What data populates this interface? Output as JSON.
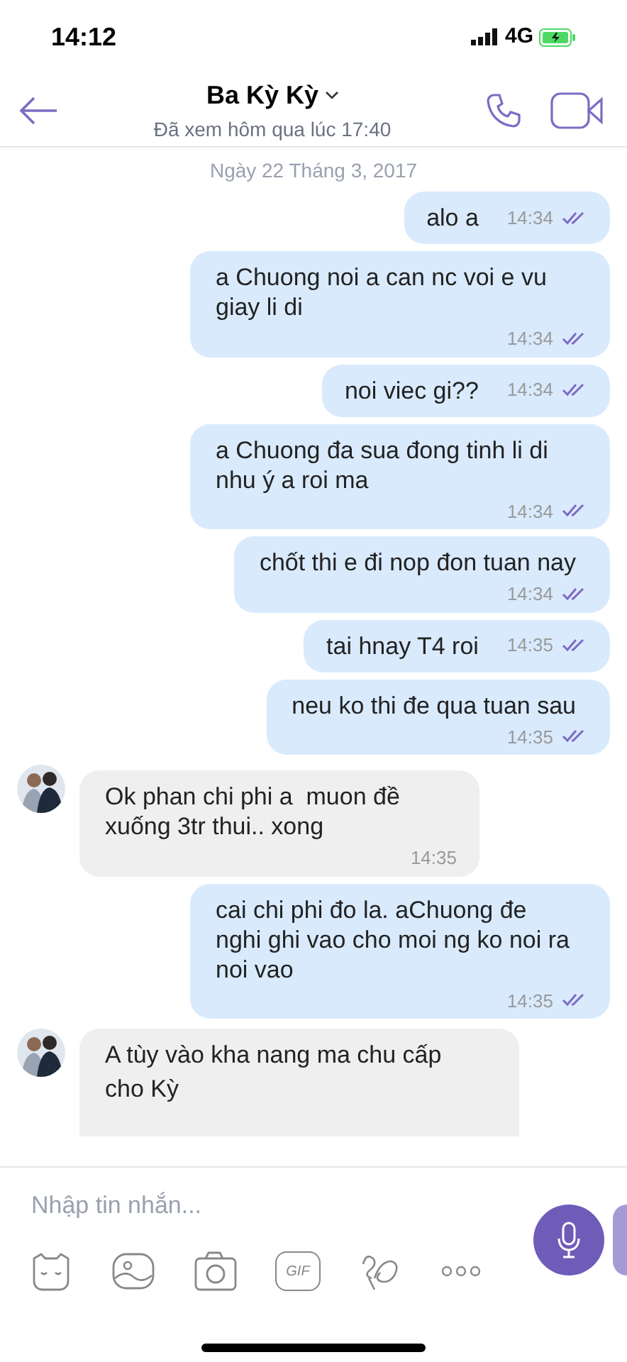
{
  "status_bar": {
    "time": "14:12",
    "network": "4G"
  },
  "header": {
    "title": "Ba Kỳ Kỳ",
    "subtitle": "Đã xem hôm qua lúc 17:40"
  },
  "date_separator": "Ngày 22 Tháng 3, 2017",
  "messages": [
    {
      "kind": "short",
      "text": "alo a",
      "time": "14:34",
      "read": true
    },
    {
      "kind": "sent",
      "text": "a Chuong noi a can nc voi e vu giay li di",
      "time": "14:34",
      "read": true
    },
    {
      "kind": "short",
      "text": "noi viec gi??",
      "time": "14:34",
      "read": true
    },
    {
      "kind": "sent",
      "text": "a Chuong đa sua đong tinh li di nhu ý a roi ma",
      "time": "14:34",
      "read": true
    },
    {
      "kind": "sent",
      "text": "chốt thi e đi nop đon tuan nay",
      "time": "14:34",
      "read": true
    },
    {
      "kind": "short",
      "text": "tai hnay T4 roi",
      "time": "14:35",
      "read": true
    },
    {
      "kind": "sent",
      "text": "neu ko thi đe qua tuan sau",
      "time": "14:35",
      "read": true
    },
    {
      "kind": "received",
      "text": "Ok phan chi phi a  muon đề xuống 3tr thui.. xong",
      "time": "14:35"
    },
    {
      "kind": "sent",
      "text": "cai chi phi đo la. aChuong đe nghi ghi vao cho moi ng ko noi ra noi vao",
      "time": "14:35",
      "read": true
    },
    {
      "kind": "partial",
      "text": "A tùy vào kha nang ma chu cấp cho Kỳ"
    }
  ],
  "composer": {
    "placeholder": "Nhập tin nhắn...",
    "gif_label": "GIF"
  }
}
